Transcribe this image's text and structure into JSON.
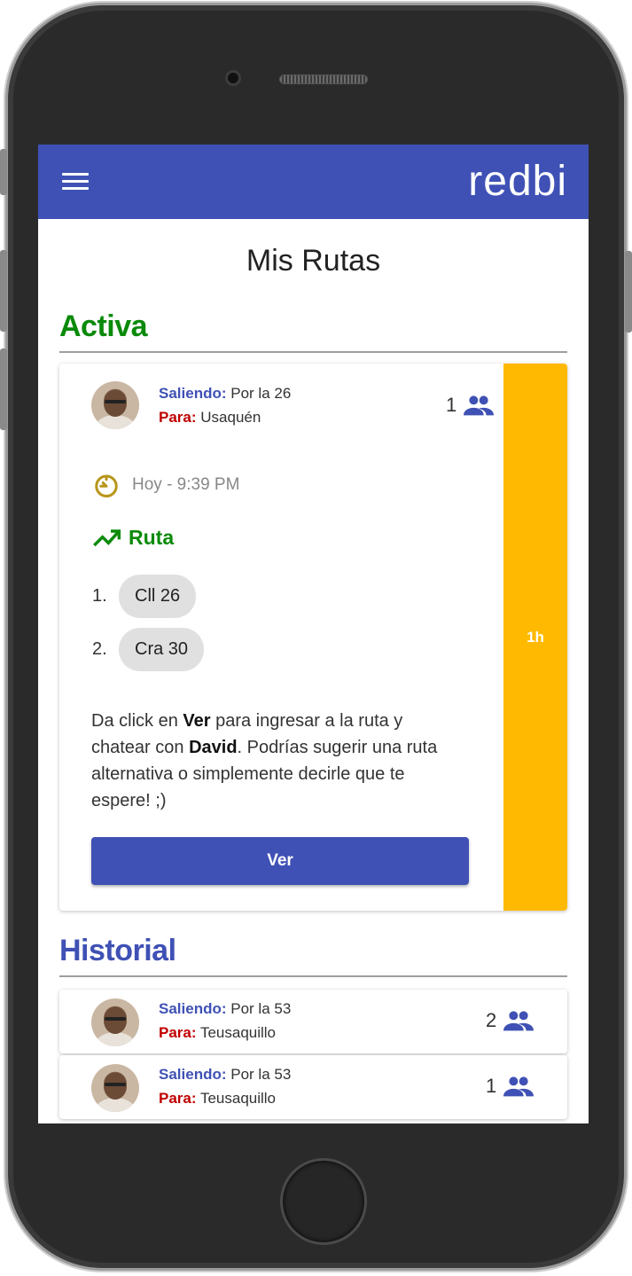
{
  "app": {
    "logo": "redbi"
  },
  "page": {
    "title": "Mis Rutas"
  },
  "active": {
    "section_title": "Activa",
    "card": {
      "from_label": "Saliendo:",
      "from_value": "Por la 26",
      "to_label": "Para:",
      "to_value": "Usaquén",
      "people_count": "1",
      "time": "Hoy - 9:39 PM",
      "route_label": "Ruta",
      "stops": [
        {
          "num": "1.",
          "name": "Cll 26"
        },
        {
          "num": "2.",
          "name": "Cra 30"
        }
      ],
      "info_text_1": "Da click en ",
      "info_bold_1": "Ver",
      "info_text_2": " para ingresar a la ruta y chatear con ",
      "info_bold_2": "David",
      "info_text_3": ". Podrías sugerir una ruta alternativa o simplemente decirle que te espere! ;)",
      "button_label": "Ver",
      "side_label": "1h",
      "side_color": "#ffb900"
    }
  },
  "history": {
    "section_title": "Historial",
    "items": [
      {
        "from_label": "Saliendo:",
        "from_value": "Por la 53",
        "to_label": "Para:",
        "to_value": "Teusaquillo",
        "people_count": "2"
      },
      {
        "from_label": "Saliendo:",
        "from_value": "Por la 53",
        "to_label": "Para:",
        "to_value": "Teusaquillo",
        "people_count": "1"
      }
    ]
  },
  "colors": {
    "primary": "#3f51b5",
    "active_green": "#0a8a0a",
    "to_red": "#c00000"
  }
}
